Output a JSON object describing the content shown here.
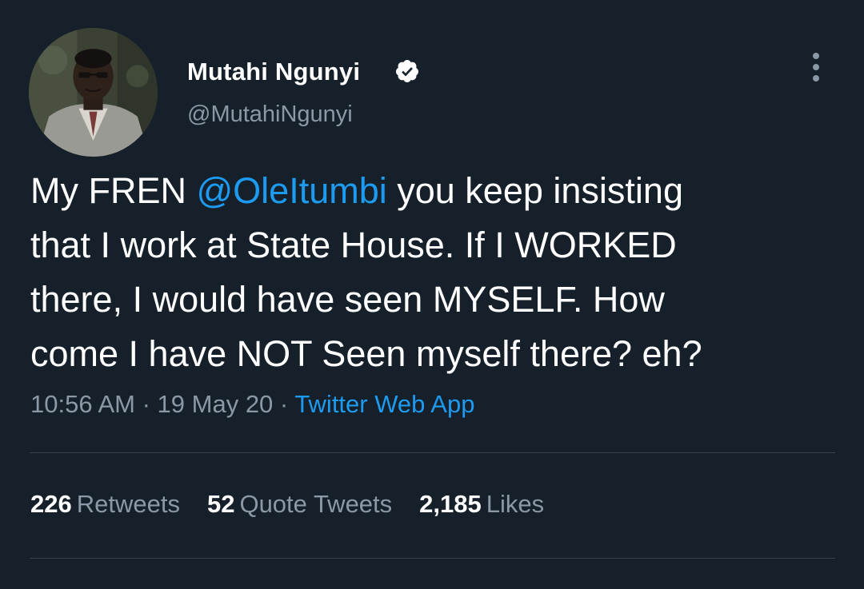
{
  "author": {
    "display_name": "Mutahi Ngunyi",
    "handle": "@MutahiNgunyi",
    "verified": true,
    "avatar_icon": "profile-photo"
  },
  "tweet": {
    "text_before": "My FREN ",
    "mention": "@OleItumbi",
    "text_after": " you keep insisting\nthat I work at State House. If I WORKED\nthere, I would have seen MYSELF. How\ncome I have NOT Seen myself there? eh?"
  },
  "meta": {
    "time": "10:56 AM",
    "separator": " · ",
    "date": "19 May 20",
    "source": "Twitter Web App"
  },
  "stats": {
    "retweets_count": "226",
    "retweets_label": "Retweets",
    "quotes_count": "52",
    "quotes_label": "Quote Tweets",
    "likes_count": "2,185",
    "likes_label": "Likes"
  },
  "colors": {
    "background": "#15202b",
    "accent": "#1d9bf0",
    "secondary_text": "#8b98a5",
    "divider": "#38444d"
  }
}
